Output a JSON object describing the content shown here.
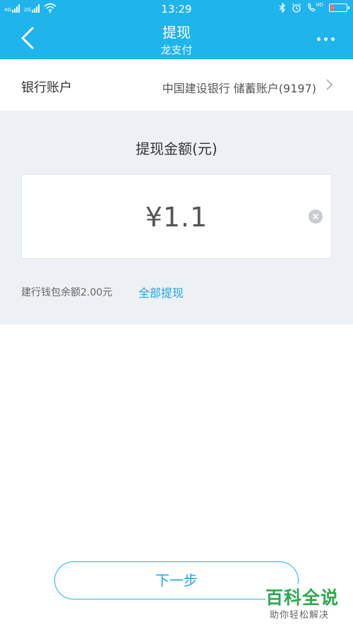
{
  "status_bar": {
    "time": "13:29",
    "net_left": "4G",
    "net_right": "2G",
    "hd_label": "HD"
  },
  "header": {
    "title": "提现",
    "subtitle": "龙支付"
  },
  "account": {
    "label": "银行账户",
    "value": "中国建设银行  储蓄账户(9197)"
  },
  "amount": {
    "title": "提现金额(元)",
    "value": "¥1.1",
    "balance_text": "建行钱包余额2.00元",
    "withdraw_all": "全部提现"
  },
  "actions": {
    "next": "下一步"
  },
  "watermark": {
    "title": "百科全说",
    "subtitle": "助你轻松解决"
  },
  "colors": {
    "accent": "#1fb4ec",
    "link": "#1fa6e0",
    "panel_bg": "#edf0f4",
    "battery_low": "#ff6a6a",
    "watermark_green": "#2fa84f"
  }
}
